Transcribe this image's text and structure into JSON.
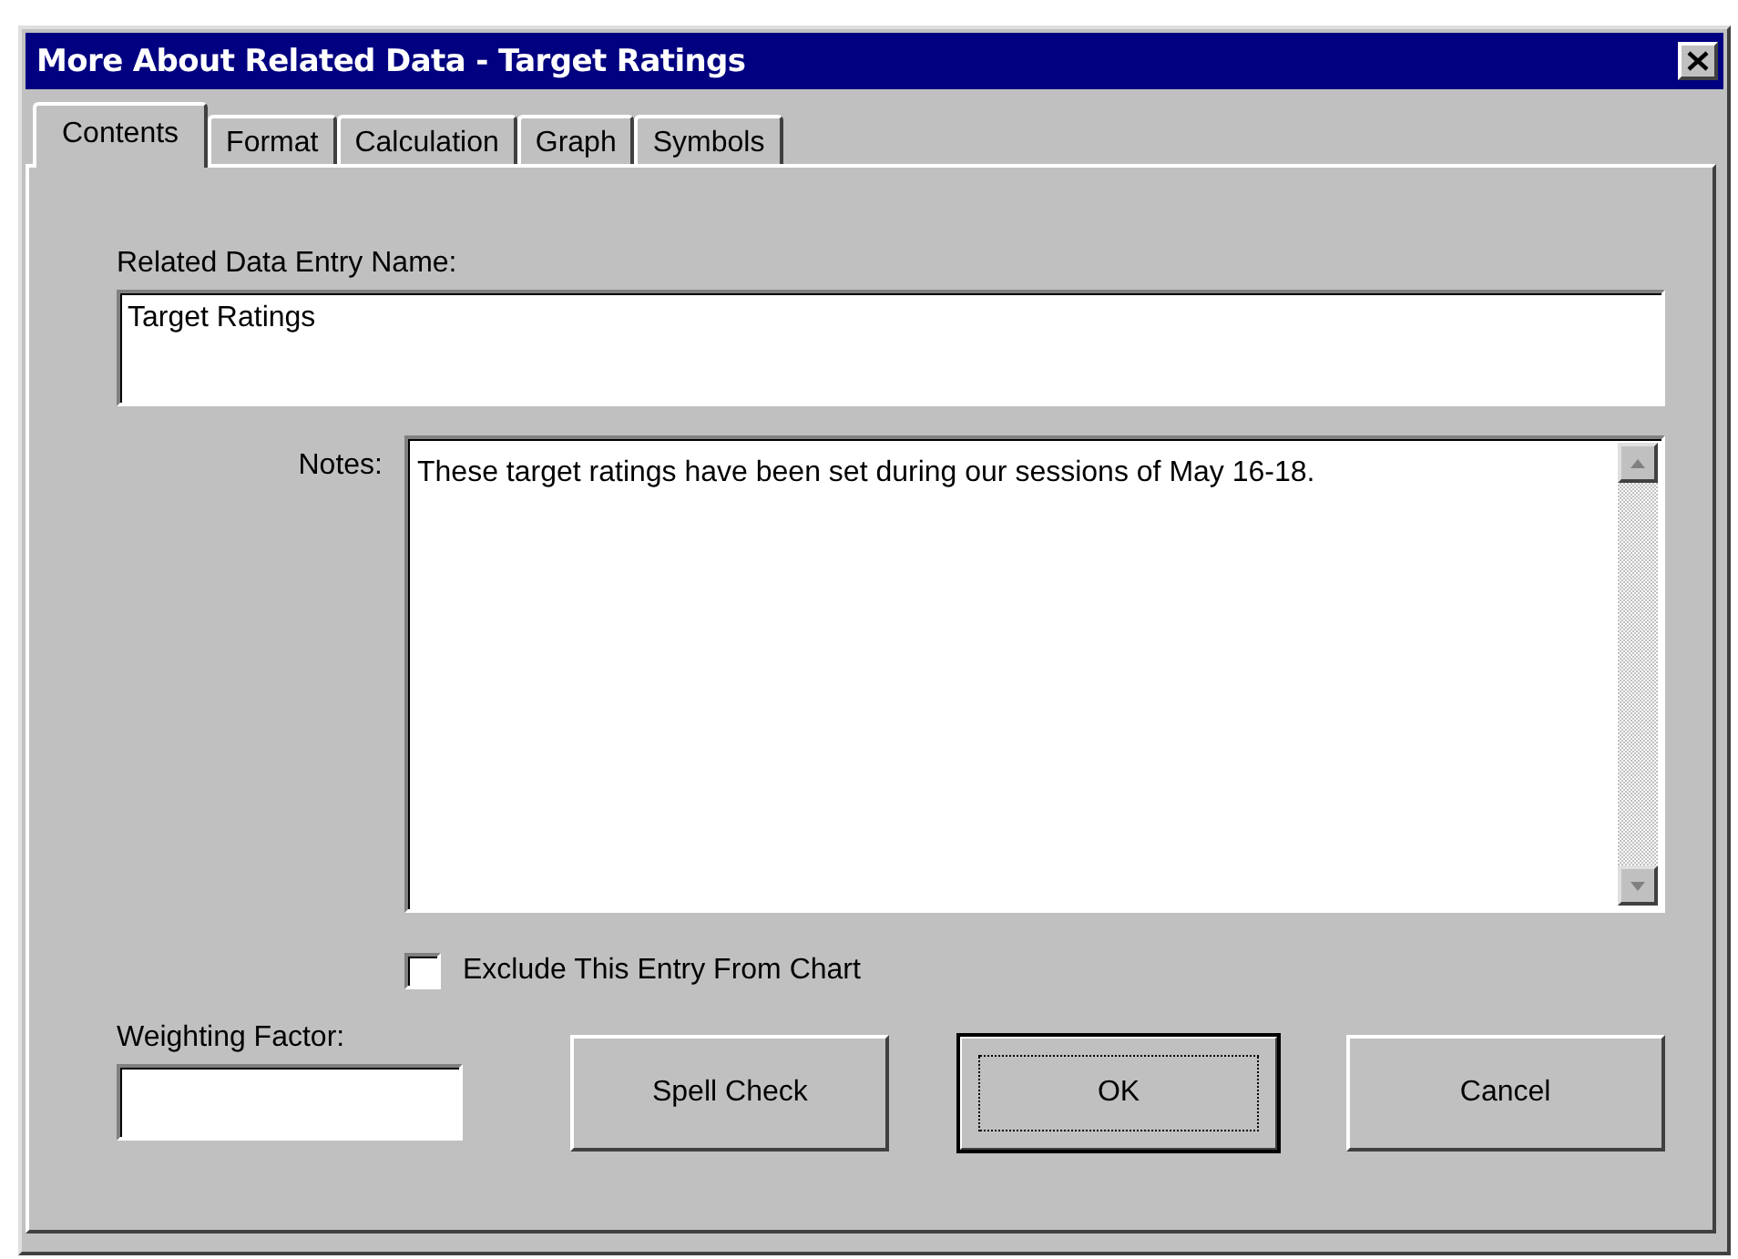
{
  "window": {
    "title": "More About Related Data - Target Ratings"
  },
  "tabs": [
    {
      "label": "Contents",
      "selected": true
    },
    {
      "label": "Format",
      "selected": false
    },
    {
      "label": "Calculation",
      "selected": false
    },
    {
      "label": "Graph",
      "selected": false
    },
    {
      "label": "Symbols",
      "selected": false
    }
  ],
  "name_field": {
    "label": "Related Data Entry Name:",
    "value": "Target Ratings"
  },
  "notes_field": {
    "label": "Notes:",
    "value": "These target ratings have been set during our sessions of May 16-18."
  },
  "exclude_checkbox": {
    "label": "Exclude This Entry From Chart",
    "checked": false
  },
  "weighting_field": {
    "label": "Weighting Factor:"
  },
  "buttons": [
    {
      "label": "Spell Check",
      "default": false
    },
    {
      "label": "OK",
      "default": true
    },
    {
      "label": "Cancel",
      "default": false
    }
  ]
}
